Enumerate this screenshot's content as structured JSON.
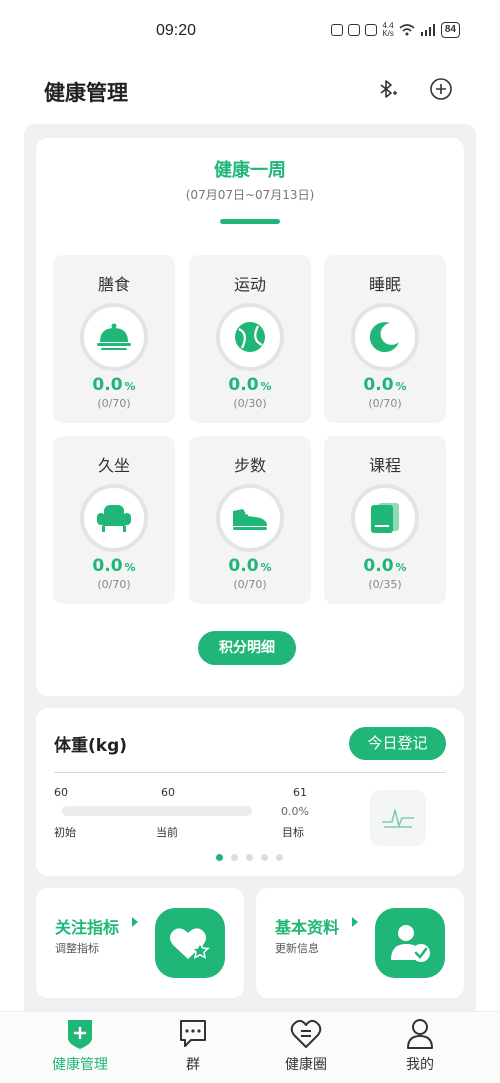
{
  "status_bar": {
    "time": "09:20",
    "netspeed_top": "4.4",
    "netspeed_bottom": "K/s",
    "battery": "84"
  },
  "header": {
    "title": "健康管理",
    "icons": [
      "bluetooth-icon",
      "add-circle-icon"
    ]
  },
  "week": {
    "title": "健康一周",
    "range": "(07月07日~07月13日)",
    "metrics": [
      {
        "name": "膳食",
        "percent": "0.0",
        "unit": "%",
        "count": "(0/70)",
        "icon": "food-cover-icon"
      },
      {
        "name": "运动",
        "percent": "0.0",
        "unit": "%",
        "count": "(0/30)",
        "icon": "tennis-ball-icon"
      },
      {
        "name": "睡眠",
        "percent": "0.0",
        "unit": "%",
        "count": "(0/70)",
        "icon": "moon-icon"
      },
      {
        "name": "久坐",
        "percent": "0.0",
        "unit": "%",
        "count": "(0/70)",
        "icon": "armchair-icon"
      },
      {
        "name": "步数",
        "percent": "0.0",
        "unit": "%",
        "count": "(0/70)",
        "icon": "sneaker-icon"
      },
      {
        "name": "课程",
        "percent": "0.0",
        "unit": "%",
        "count": "(0/35)",
        "icon": "book-icon"
      }
    ],
    "points_button": "积分明细"
  },
  "weight": {
    "title": "体重(kg)",
    "checkin_button": "今日登记",
    "initial_value": "60",
    "current_value": "60",
    "target_value": "61",
    "progress_text": "0.0%",
    "progress_fraction": 0,
    "initial_label": "初始",
    "current_label": "当前",
    "target_label": "目标",
    "pager": {
      "count": 5,
      "active": 0
    }
  },
  "shortcuts": [
    {
      "title": "关注指标",
      "subtitle": "调整指标",
      "icon": "heart-star-icon"
    },
    {
      "title": "基本资料",
      "subtitle": "更新信息",
      "icon": "user-check-icon"
    }
  ],
  "nav": [
    {
      "label": "健康管理",
      "icon": "health-shield-icon",
      "active": true
    },
    {
      "label": "群",
      "icon": "chat-bubble-icon",
      "active": false
    },
    {
      "label": "健康圈",
      "icon": "heart-equal-icon",
      "active": false
    },
    {
      "label": "我的",
      "icon": "person-icon",
      "active": false
    }
  ],
  "colors": {
    "accent": "#1fb677",
    "tile_bg": "#f4f4f5",
    "page_bg": "#f0f1f3"
  }
}
